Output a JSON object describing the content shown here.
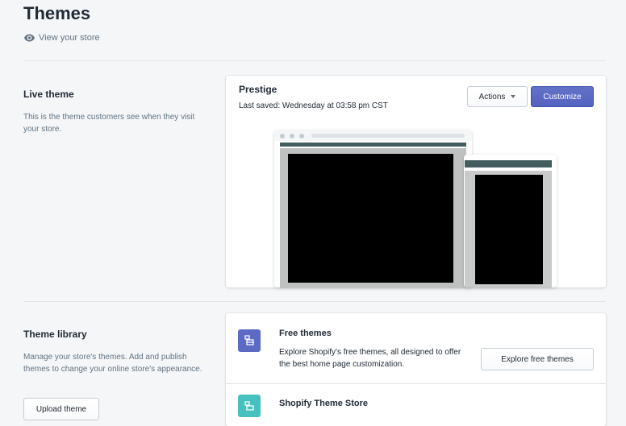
{
  "header": {
    "title": "Themes",
    "view_store_label": "View your store"
  },
  "live_theme": {
    "section_title": "Live theme",
    "section_description": "This is the theme customers see when they visit your store.",
    "theme_name": "Prestige",
    "last_saved": "Last saved: Wednesday at 03:58 pm CST",
    "actions_label": "Actions",
    "customize_label": "Customize",
    "icons": [
      "caret-down-icon"
    ]
  },
  "theme_library": {
    "section_title": "Theme library",
    "section_description": "Manage your store's themes. Add and publish themes to change your online store's appearance.",
    "upload_label": "Upload theme",
    "rows": [
      {
        "title": "Free themes",
        "description": "Explore Shopify's free themes, all designed to offer the best home page customization.",
        "button_label": "Explore free themes",
        "icon": "free-themes-icon",
        "icon_color": "#5c6ac4"
      },
      {
        "title": "Shopify Theme Store",
        "icon": "theme-store-icon",
        "icon_color": "#47c1bf"
      }
    ]
  },
  "colors": {
    "primary": "#5c6ac4",
    "theme_bar": "#435c5d",
    "background": "#f4f6f8"
  }
}
